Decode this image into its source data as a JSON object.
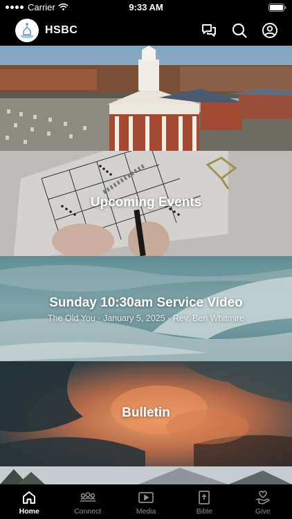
{
  "status_bar": {
    "carrier": "Carrier",
    "time": "9:33 AM"
  },
  "header": {
    "title": "HSBC",
    "logo_alt_icon": "church-logo-icon",
    "actions": [
      "chat-icon",
      "search-icon",
      "profile-icon"
    ]
  },
  "feed": {
    "cards": [
      {
        "title": "",
        "subtitle": ""
      },
      {
        "title": "Upcoming Events",
        "subtitle": ""
      },
      {
        "title": "Sunday 10:30am Service Video",
        "subtitle": "The Old You · January 5, 2025 · Rev. Ben Whitmire"
      },
      {
        "title": "Bulletin",
        "subtitle": ""
      }
    ]
  },
  "tabs": [
    {
      "label": "Home",
      "icon": "home-icon",
      "active": true
    },
    {
      "label": "Connect",
      "icon": "people-icon",
      "active": false
    },
    {
      "label": "Media",
      "icon": "play-icon",
      "active": false
    },
    {
      "label": "Bible",
      "icon": "bible-icon",
      "active": false
    },
    {
      "label": "Give",
      "icon": "give-icon",
      "active": false
    }
  ],
  "colors": {
    "accent": "#ffffff",
    "inactive": "#8e8e8e",
    "background": "#000000"
  }
}
